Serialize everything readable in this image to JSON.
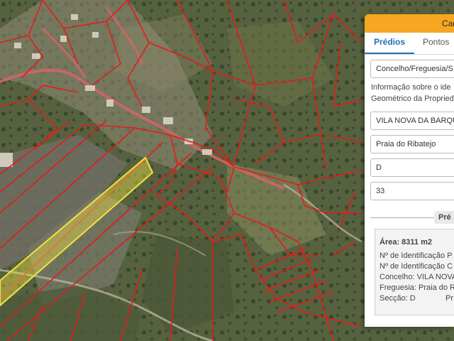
{
  "map": {
    "colors": {
      "parcel_lines": "#e41b1b",
      "selected_fill": "#e8d94c",
      "selected_stroke": "#f2e33a",
      "roads": "#e06060"
    }
  },
  "panel": {
    "header_title": "Cad",
    "tabs": [
      {
        "label": "Prédios",
        "active": true
      },
      {
        "label": "Pontos",
        "active": false
      }
    ],
    "select_placeholder": "Concelho/Freguesia/S",
    "info_line1": "Informação sobre o ide",
    "info_line2": "Geométrico da Propried",
    "concelho_value": "VILA NOVA DA BARQU",
    "freguesia_value": "Praia do Ribatejo",
    "seccao_value": "D",
    "artigo_value": "33",
    "separator_label": "Pré",
    "result": {
      "area": "Área: 8311 m2",
      "line1": "Nº de Identificação P",
      "line2": "Nº de Identificação C",
      "line3": "Concelho: VILA NOVA",
      "line4": "Freguesia: Praia do R",
      "line5": "Secção: D",
      "line5_extra": "Pr"
    }
  }
}
